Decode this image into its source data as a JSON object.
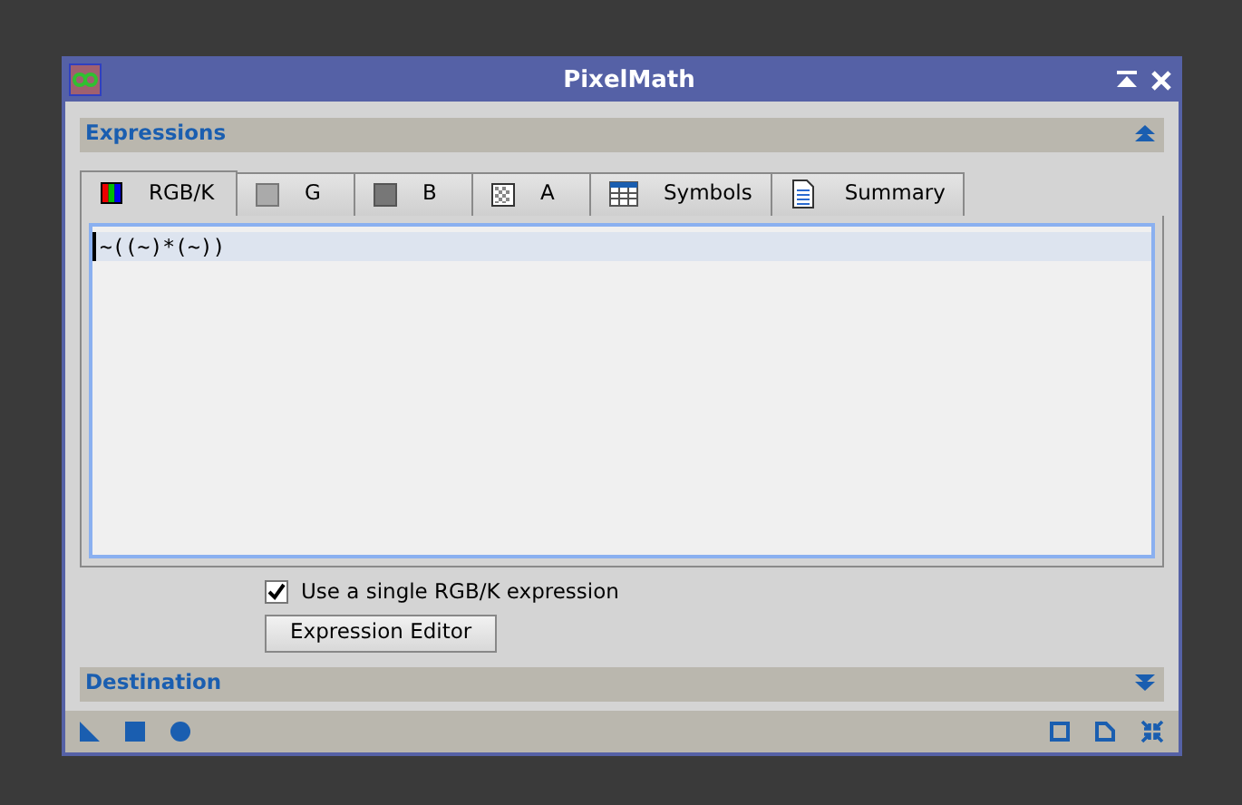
{
  "window": {
    "title": "PixelMath"
  },
  "expressions_section": {
    "title": "Expressions",
    "expanded": true
  },
  "tabs": [
    {
      "label": "RGB/K",
      "kind": "rgb",
      "selected": true
    },
    {
      "label": "G",
      "kind": "light",
      "selected": false
    },
    {
      "label": "B",
      "kind": "dark",
      "selected": false
    },
    {
      "label": "A",
      "kind": "alpha",
      "selected": false
    },
    {
      "label": "Symbols",
      "kind": "table",
      "selected": false
    },
    {
      "label": "Summary",
      "kind": "doc",
      "selected": false
    }
  ],
  "editor": {
    "lines": [
      "~((~)*(~))"
    ]
  },
  "single_expression": {
    "label": "Use a single RGB/K expression",
    "checked": true
  },
  "expression_editor_button": "Expression Editor",
  "destination_section": {
    "title": "Destination",
    "expanded": false
  }
}
